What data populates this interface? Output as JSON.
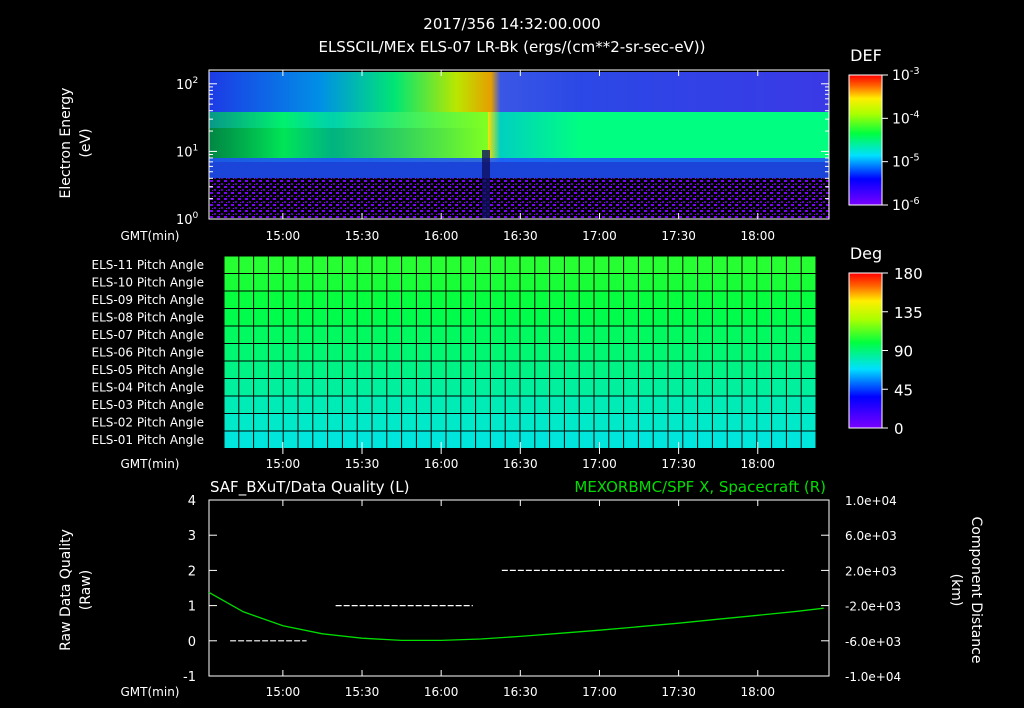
{
  "header": {
    "timestamp": "2017/356 14:32:00.000",
    "subtitle": "ELSSCIL/MEx ELS-07 LR-Bk  (ergs/(cm**2-sr-sec-eV))"
  },
  "chart_data": [
    {
      "type": "heatmap",
      "name": "els-spectrogram",
      "ylabel": "Electron Energy",
      "yunit": "(eV)",
      "yscale": "log",
      "ylim": [
        1,
        160
      ],
      "y_ticks": [
        "10^0",
        "10^1",
        "10^2"
      ],
      "xlabel": "GMT(min)",
      "x_ticks": [
        "15:00",
        "15:30",
        "16:00",
        "16:30",
        "17:00",
        "17:30",
        "18:00"
      ],
      "colorbar": {
        "label": "DEF",
        "scale": "log",
        "range": [
          1e-06,
          0.001
        ],
        "ticks": [
          "10^-3",
          "10^-4",
          "10^-5",
          "10^-6"
        ]
      }
    },
    {
      "type": "heatmap",
      "name": "pitch-angle",
      "rows": [
        {
          "label": "ELS-11 Pitch Angle",
          "value": 105
        },
        {
          "label": "ELS-10 Pitch Angle",
          "value": 103
        },
        {
          "label": "ELS-09 Pitch Angle",
          "value": 100
        },
        {
          "label": "ELS-08 Pitch Angle",
          "value": 97
        },
        {
          "label": "ELS-07 Pitch Angle",
          "value": 94
        },
        {
          "label": "ELS-06 Pitch Angle",
          "value": 91
        },
        {
          "label": "ELS-05 Pitch Angle",
          "value": 88
        },
        {
          "label": "ELS-04 Pitch Angle",
          "value": 84
        },
        {
          "label": "ELS-03 Pitch Angle",
          "value": 80
        },
        {
          "label": "ELS-02 Pitch Angle",
          "value": 77
        },
        {
          "label": "ELS-01 Pitch Angle",
          "value": 74
        }
      ],
      "xlabel": "GMT(min)",
      "x_ticks": [
        "15:00",
        "15:30",
        "16:00",
        "16:30",
        "17:00",
        "17:30",
        "18:00"
      ],
      "colorbar": {
        "label": "Deg",
        "range": [
          0,
          180
        ],
        "ticks": [
          "180",
          "135",
          "90",
          "45",
          "0"
        ]
      }
    },
    {
      "type": "line",
      "name": "data-quality",
      "left_title": "SAF_BXuT/Data Quality (L)",
      "right_title": "MEXORBMC/SPF X, Spacecraft (R)",
      "ylabel_left": "Raw Data Quality",
      "yunit_left": "(Raw)",
      "ylim_left": [
        -1,
        4
      ],
      "yticks_left": [
        "4",
        "3",
        "2",
        "1",
        "0",
        "-1"
      ],
      "ylabel_right": "Component Distance",
      "yunit_right": "(km)",
      "ylim_right": [
        -10000,
        10000
      ],
      "yticks_right": [
        "1.0e+04",
        "6.0e+03",
        "2.0e+03",
        "-2.0e+03",
        "-6.0e+03",
        "-1.0e+04"
      ],
      "xlabel": "GMT(min)",
      "x_ticks": [
        "15:00",
        "15:30",
        "16:00",
        "16:30",
        "17:00",
        "17:30",
        "18:00"
      ],
      "series": [
        {
          "axis": "left",
          "color": "#ffffff",
          "segments": [
            {
              "x_start": "14:40",
              "x_end": "15:09",
              "y": 0
            },
            {
              "x_start": "15:20",
              "x_end": "16:12",
              "y": 1
            },
            {
              "x_start": "16:23",
              "x_end": "18:10",
              "y": 2
            }
          ]
        },
        {
          "axis": "right",
          "color": "#00dd00",
          "x": [
            "14:32",
            "14:45",
            "15:00",
            "15:15",
            "15:30",
            "15:45",
            "16:00",
            "16:15",
            "16:30",
            "16:45",
            "17:00",
            "17:15",
            "17:30",
            "17:45",
            "18:00",
            "18:15",
            "18:25"
          ],
          "y": [
            -500,
            -2700,
            -4300,
            -5200,
            -5700,
            -5950,
            -5950,
            -5800,
            -5500,
            -5150,
            -4800,
            -4400,
            -4000,
            -3550,
            -3100,
            -2650,
            -2300
          ]
        }
      ]
    }
  ]
}
